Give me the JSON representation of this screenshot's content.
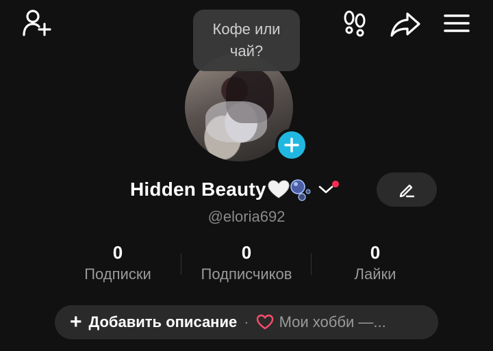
{
  "tooltip": {
    "text": "Кофе или чай?"
  },
  "profile": {
    "display_name": "Hidden Beauty",
    "username": "@eloria692"
  },
  "stats": [
    {
      "value": "0",
      "label": "Подписки"
    },
    {
      "value": "0",
      "label": "Подписчиков"
    },
    {
      "value": "0",
      "label": "Лайки"
    }
  ],
  "bio": {
    "add_label": "Добавить описание",
    "separator": "·",
    "hobby_label": "Мои хобби —..."
  },
  "icons": {
    "add_friend": "person-add-icon",
    "footprints": "footprints-icon",
    "share": "share-arrow-icon",
    "menu": "hamburger-menu-icon",
    "edit": "pencil-icon",
    "heart": "heart-icon"
  },
  "colors": {
    "background": "#111111",
    "accent_blue": "#20b8e0",
    "notification_red": "#ff2d55",
    "heart_pink": "#ff4d6d"
  }
}
